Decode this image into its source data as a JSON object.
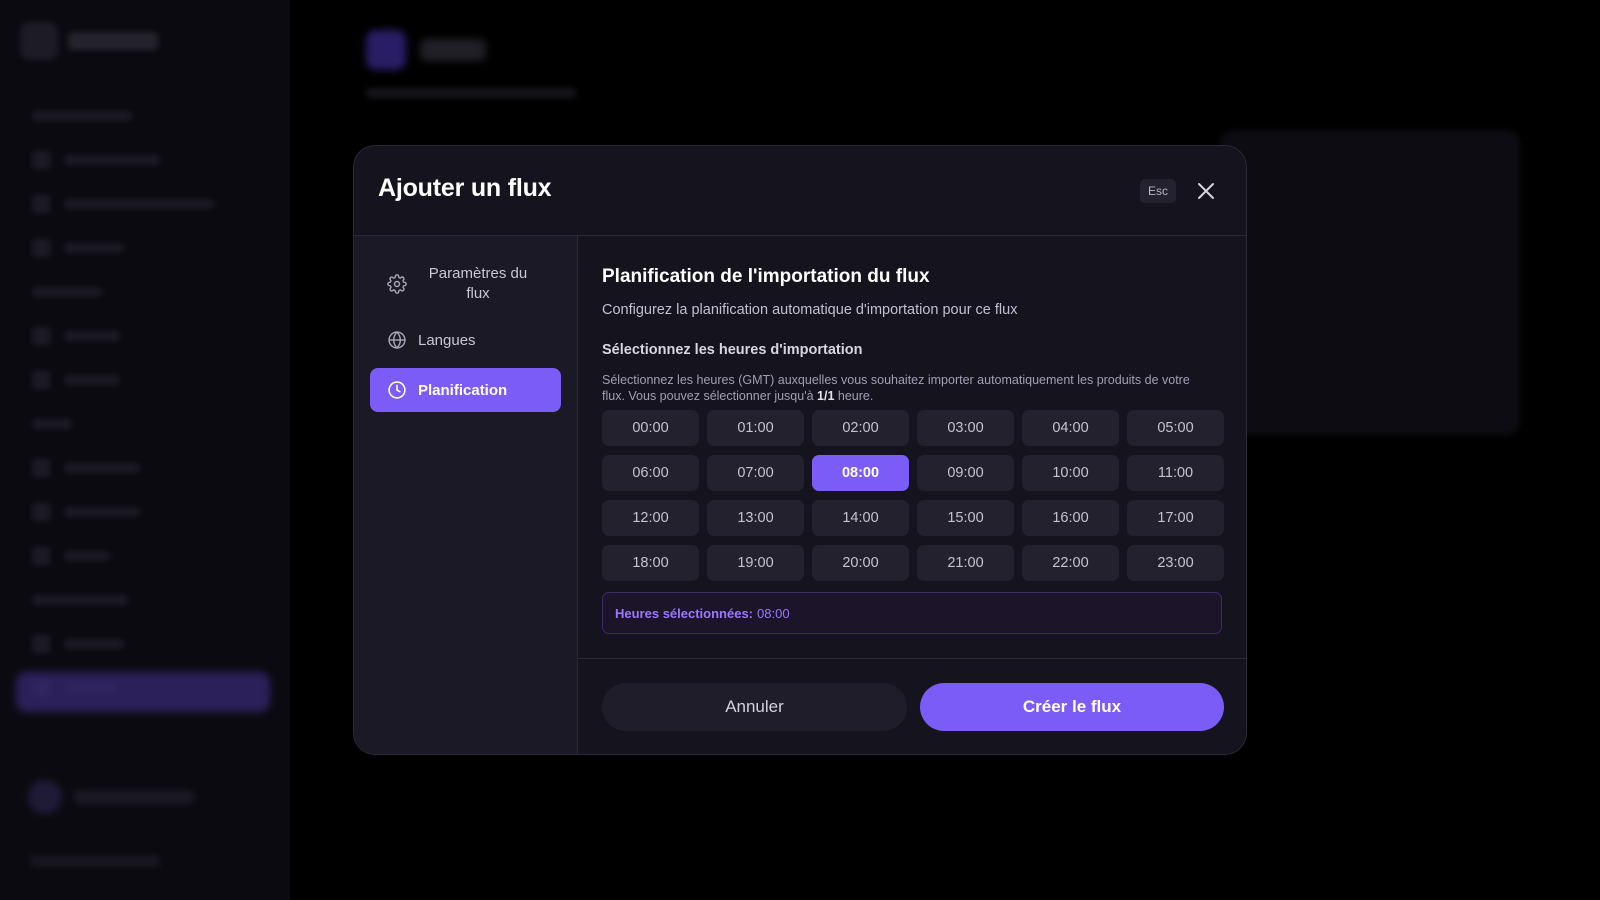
{
  "modal": {
    "title": "Ajouter un flux",
    "esc_label": "Esc",
    "close_icon": "close-icon"
  },
  "nav": {
    "items": [
      {
        "label": "Paramètres du flux",
        "icon": "gear-icon",
        "active": false
      },
      {
        "label": "Langues",
        "icon": "globe-icon",
        "active": false
      },
      {
        "label": "Planification",
        "icon": "clock-icon",
        "active": true
      }
    ]
  },
  "content": {
    "title": "Planification de l'importation du flux",
    "subtitle": "Configurez la planification automatique d'importation pour ce flux",
    "section_label": "Sélectionnez les heures d'importation",
    "help_text_before": "Sélectionnez les heures (GMT) auxquelles vous souhaitez importer automatiquement les produits de votre flux. Vous pouvez sélectionner jusqu'à ",
    "help_limit": "1/1",
    "help_text_after": " heure."
  },
  "hours": [
    "00:00",
    "01:00",
    "02:00",
    "03:00",
    "04:00",
    "05:00",
    "06:00",
    "07:00",
    "08:00",
    "09:00",
    "10:00",
    "11:00",
    "12:00",
    "13:00",
    "14:00",
    "15:00",
    "16:00",
    "17:00",
    "18:00",
    "19:00",
    "20:00",
    "21:00",
    "22:00",
    "23:00"
  ],
  "selected_hours": [
    "08:00"
  ],
  "summary": {
    "label": "Heures sélectionnées:",
    "value": "08:00"
  },
  "footer": {
    "cancel_label": "Annuler",
    "create_label": "Créer le flux"
  },
  "colors": {
    "accent": "#7c5cf7",
    "modal_bg": "#15131d",
    "nav_bg": "#1b1925"
  }
}
